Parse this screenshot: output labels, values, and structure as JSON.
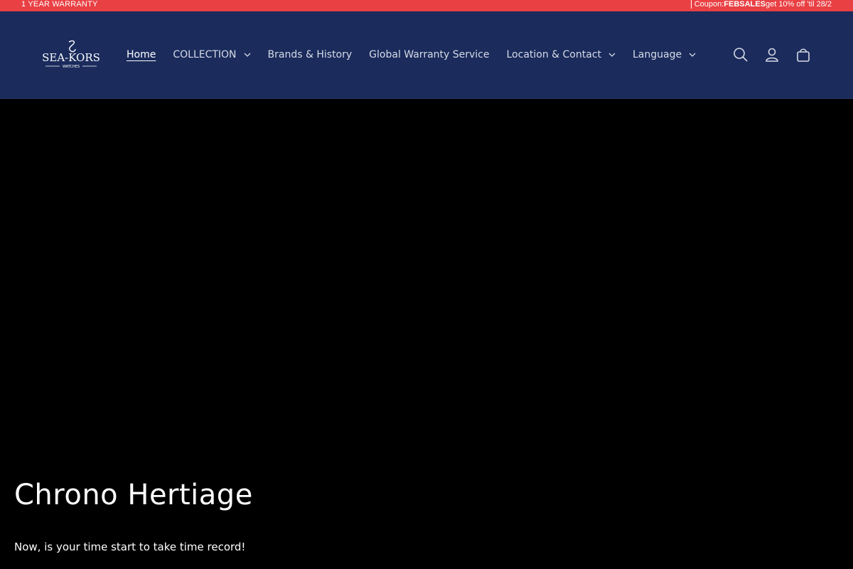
{
  "announcement": {
    "left_text": "1 YEAR WARRANTY",
    "coupon_prefix": "Coupon: ",
    "coupon_code": "FEBSALES",
    "coupon_suffix": " get 10% off 'til 28/2",
    "bg_color": "#e94044"
  },
  "header": {
    "bg_color": "#1a2b5c",
    "logo": {
      "brand": "SEA-KORS",
      "tagline": "WATCHES"
    },
    "nav": [
      {
        "label": "Home",
        "active": true
      },
      {
        "label": "COLLECTION",
        "has_dropdown": true
      },
      {
        "label": "Brands & History"
      },
      {
        "label": "Global Warranty Service"
      },
      {
        "label": "Location & Contact",
        "has_dropdown": true
      },
      {
        "label": "Language",
        "has_dropdown": true
      }
    ],
    "icons": [
      "search-icon",
      "account-icon",
      "cart-icon"
    ]
  },
  "hero": {
    "title": "Chrono Hertiage",
    "subtitle": "Now, is your time start to take time record!"
  }
}
